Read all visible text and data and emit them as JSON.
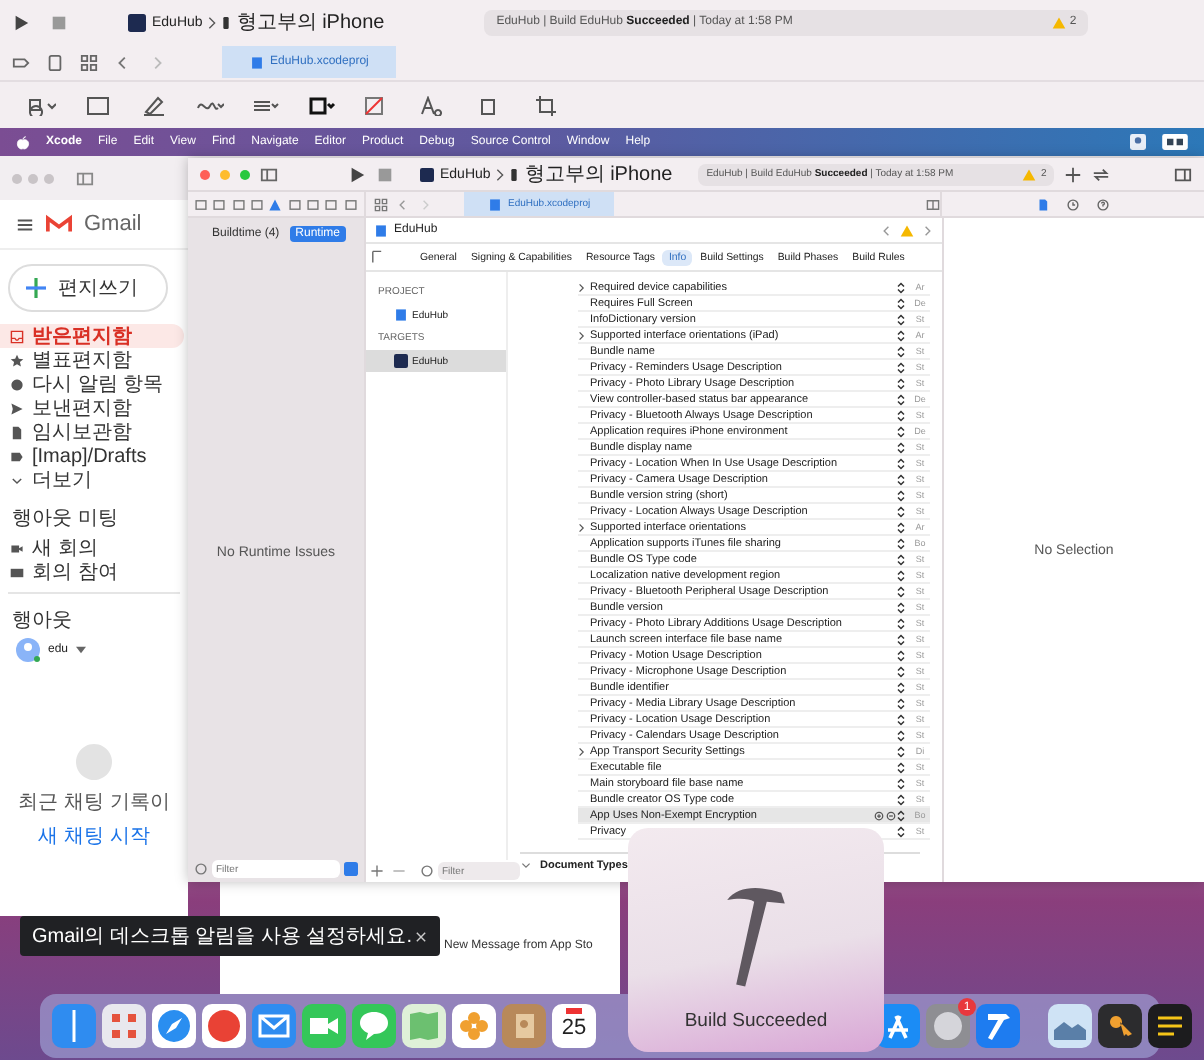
{
  "background_window": {
    "scheme": "EduHub",
    "device": "형고부의 iPhone",
    "status": {
      "message": "EduHub | Build EduHub **Succeeded** | Today at 1:58 PM",
      "warnings": "2"
    },
    "tab": "EduHub.xcodeproj"
  },
  "menu_bar": {
    "items": [
      "Xcode",
      "File",
      "Edit",
      "View",
      "Find",
      "Navigate",
      "Editor",
      "Product",
      "Debug",
      "Source Control",
      "Window",
      "Help"
    ]
  },
  "gmail": {
    "logo": "Gmail",
    "compose": "편지쓰기",
    "folders": [
      {
        "label": "받은편지함",
        "selected": true
      },
      {
        "label": "별표편지함",
        "selected": false
      },
      {
        "label": "다시 알림 항목",
        "selected": false
      },
      {
        "label": "보낸편지함",
        "selected": false
      },
      {
        "label": "임시보관함",
        "selected": false
      },
      {
        "label": "[Imap]/Drafts",
        "selected": false
      },
      {
        "label": "더보기",
        "selected": false
      }
    ],
    "meet": {
      "title": "행아웃 미팅",
      "items": [
        "새 회의",
        "회의 참여"
      ]
    },
    "hangouts": {
      "title": "행아웃",
      "user": "edu"
    },
    "chat_empty": "최근 채팅 기록이",
    "chat_link": "새 채팅 시작"
  },
  "xcode": {
    "scheme": "EduHub",
    "device": "형고부의 iPhone",
    "status": {
      "message": "EduHub | Build EduHub **Succeeded** | Today at 1:58 PM",
      "warnings": "2"
    },
    "tab": "EduHub.xcodeproj",
    "navigator": {
      "segments": [
        {
          "label": "Buildtime (4)",
          "selected": false
        },
        {
          "label": "Runtime",
          "selected": true
        }
      ],
      "empty": "No Runtime Issues",
      "filter": {
        "placeholder": "Filter"
      }
    },
    "editor": {
      "path": "EduHub",
      "tabs": [
        {
          "label": "General",
          "selected": false
        },
        {
          "label": "Signing & Capabilities",
          "selected": false
        },
        {
          "label": "Resource Tags",
          "selected": false
        },
        {
          "label": "Info",
          "selected": true
        },
        {
          "label": "Build Settings",
          "selected": false
        },
        {
          "label": "Build Phases",
          "selected": false
        },
        {
          "label": "Build Rules",
          "selected": false
        }
      ],
      "project_header": "PROJECT",
      "project": "EduHub",
      "targets_header": "TARGETS",
      "targets": [
        {
          "label": "EduHub",
          "selected": true
        }
      ],
      "rows": [
        {
          "key": "Required device capabilities",
          "value": "Ar",
          "disclosure": true,
          "selected": false
        },
        {
          "key": "Requires Full Screen",
          "value": "De",
          "disclosure": false,
          "selected": false
        },
        {
          "key": "InfoDictionary version",
          "value": "St",
          "disclosure": false,
          "selected": false
        },
        {
          "key": "Supported interface orientations (iPad)",
          "value": "Ar",
          "disclosure": true,
          "selected": false
        },
        {
          "key": "Bundle name",
          "value": "St",
          "disclosure": false,
          "selected": false
        },
        {
          "key": "Privacy - Reminders Usage Description",
          "value": "St",
          "disclosure": false,
          "selected": false
        },
        {
          "key": "Privacy - Photo Library Usage Description",
          "value": "St",
          "disclosure": false,
          "selected": false
        },
        {
          "key": "View controller-based status bar appearance",
          "value": "De",
          "disclosure": false,
          "selected": false
        },
        {
          "key": "Privacy - Bluetooth Always Usage Description",
          "value": "St",
          "disclosure": false,
          "selected": false
        },
        {
          "key": "Application requires iPhone environment",
          "value": "De",
          "disclosure": false,
          "selected": false
        },
        {
          "key": "Bundle display name",
          "value": "St",
          "disclosure": false,
          "selected": false
        },
        {
          "key": "Privacy - Location When In Use Usage Description",
          "value": "St",
          "disclosure": false,
          "selected": false
        },
        {
          "key": "Privacy - Camera Usage Description",
          "value": "St",
          "disclosure": false,
          "selected": false
        },
        {
          "key": "Bundle version string (short)",
          "value": "St",
          "disclosure": false,
          "selected": false
        },
        {
          "key": "Privacy - Location Always Usage Description",
          "value": "St",
          "disclosure": false,
          "selected": false
        },
        {
          "key": "Supported interface orientations",
          "value": "Ar",
          "disclosure": true,
          "selected": false
        },
        {
          "key": "Application supports iTunes file sharing",
          "value": "Bo",
          "disclosure": false,
          "selected": false
        },
        {
          "key": "Bundle OS Type code",
          "value": "St",
          "disclosure": false,
          "selected": false
        },
        {
          "key": "Localization native development region",
          "value": "St",
          "disclosure": false,
          "selected": false
        },
        {
          "key": "Privacy - Bluetooth Peripheral Usage Description",
          "value": "St",
          "disclosure": false,
          "selected": false
        },
        {
          "key": "Bundle version",
          "value": "St",
          "disclosure": false,
          "selected": false
        },
        {
          "key": "Privacy - Photo Library Additions Usage Description",
          "value": "St",
          "disclosure": false,
          "selected": false
        },
        {
          "key": "Launch screen interface file base name",
          "value": "St",
          "disclosure": false,
          "selected": false
        },
        {
          "key": "Privacy - Motion Usage Description",
          "value": "St",
          "disclosure": false,
          "selected": false
        },
        {
          "key": "Privacy - Microphone Usage Description",
          "value": "St",
          "disclosure": false,
          "selected": false
        },
        {
          "key": "Bundle identifier",
          "value": "St",
          "disclosure": false,
          "selected": false
        },
        {
          "key": "Privacy - Media Library Usage Description",
          "value": "St",
          "disclosure": false,
          "selected": false
        },
        {
          "key": "Privacy - Location Usage Description",
          "value": "St",
          "disclosure": false,
          "selected": false
        },
        {
          "key": "Privacy - Calendars Usage Description",
          "value": "St",
          "disclosure": false,
          "selected": false
        },
        {
          "key": "App Transport Security Settings",
          "value": "Di",
          "disclosure": true,
          "selected": false
        },
        {
          "key": "Executable file",
          "value": "St",
          "disclosure": false,
          "selected": false
        },
        {
          "key": "Main storyboard file base name",
          "value": "St",
          "disclosure": false,
          "selected": false
        },
        {
          "key": "Bundle creator OS Type code",
          "value": "St",
          "disclosure": false,
          "selected": false
        },
        {
          "key": "App Uses Non-Exempt Encryption",
          "value": "Bo",
          "disclosure": false,
          "selected": true
        },
        {
          "key": "Privacy",
          "value": "St",
          "disclosure": false,
          "selected": false
        }
      ],
      "section": "Document Types",
      "filter": {
        "placeholder": "Filter"
      }
    },
    "inspector": {
      "empty": "No Selection"
    }
  },
  "toast": {
    "message": "Gmail의 데스크톱 알림을 사용 설정하세요."
  },
  "mail_rows": [
    "New Message from App Sto"
  ],
  "dock": {
    "calendar_day": "25",
    "settings_badge": "1"
  },
  "hud": {
    "message": "Build Succeeded"
  }
}
